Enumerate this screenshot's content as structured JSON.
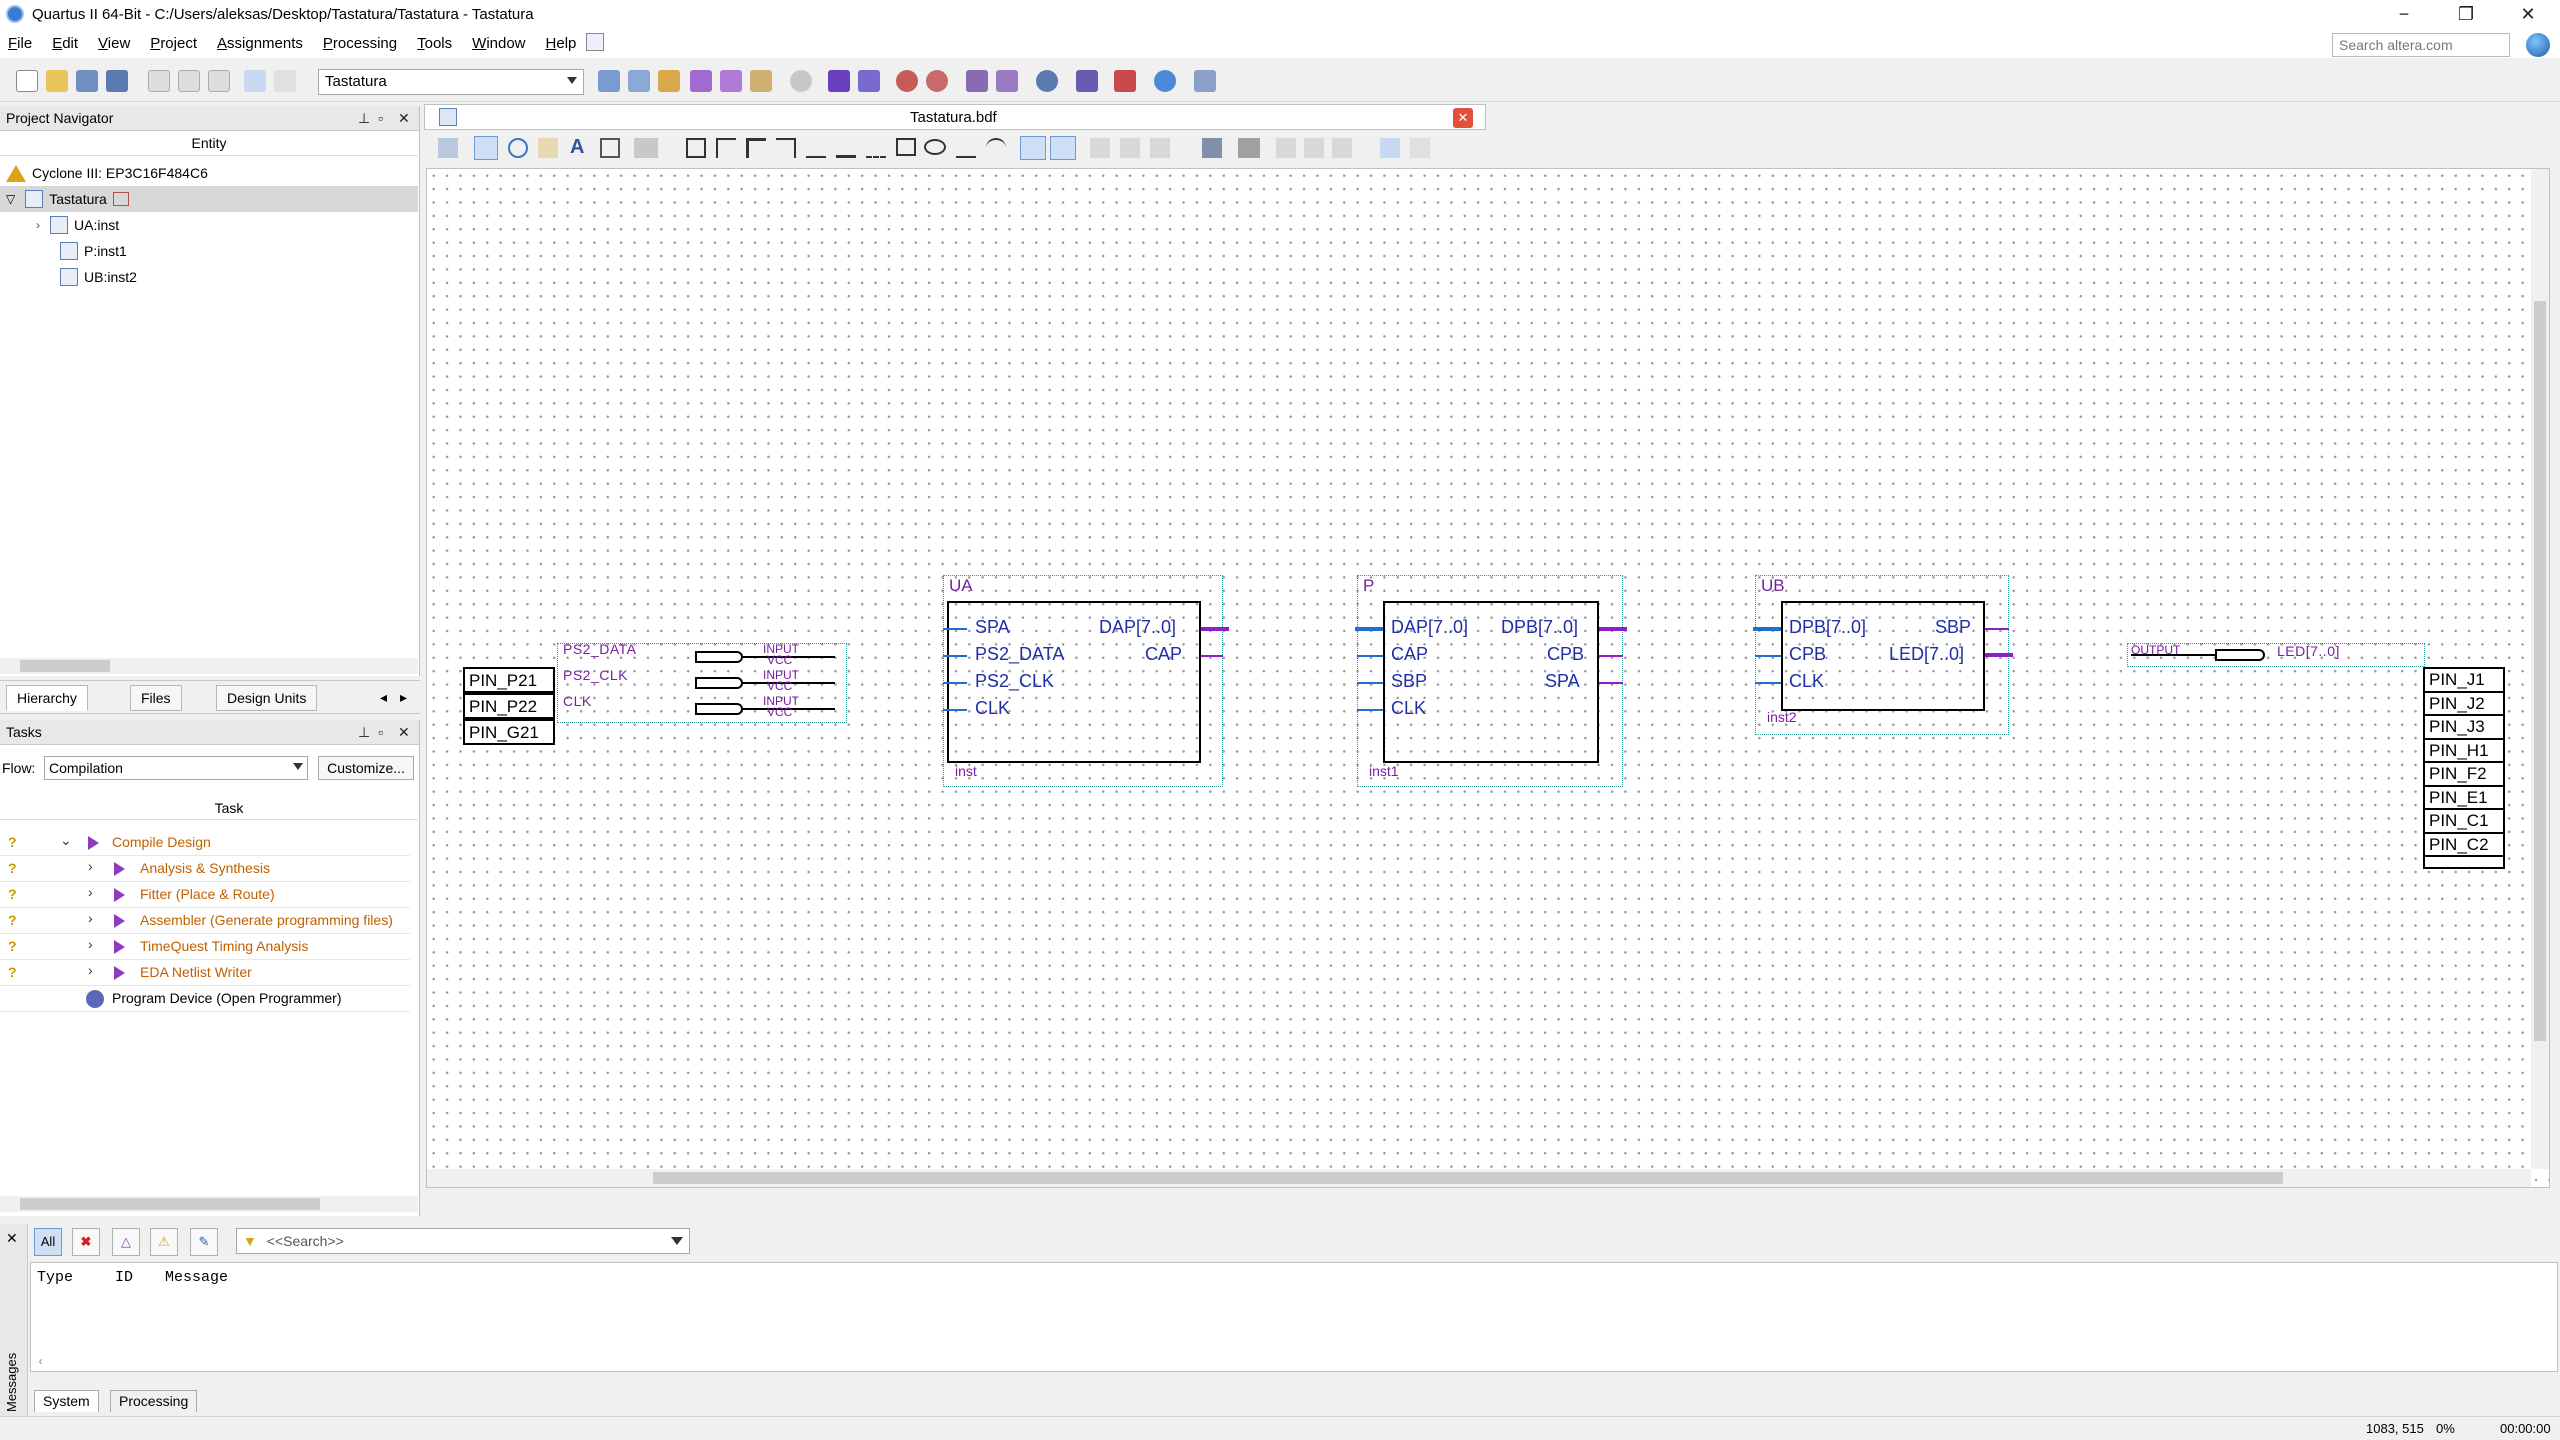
{
  "window": {
    "title": "Quartus II 64-Bit - C:/Users/aleksas/Desktop/Tastatura/Tastatura - Tastatura",
    "minimize": "−",
    "restore": "❐",
    "close": "✕"
  },
  "menu": [
    "File",
    "Edit",
    "View",
    "Project",
    "Assignments",
    "Processing",
    "Tools",
    "Window",
    "Help"
  ],
  "search": {
    "placeholder": "Search altera.com"
  },
  "toolbar": {
    "project": "Tastatura"
  },
  "navigator": {
    "title": "Project Navigator",
    "column": "Entity",
    "device": "Cyclone III: EP3C16F484C6",
    "root": "Tastatura",
    "children": [
      "UA:inst",
      "P:inst1",
      "UB:inst2"
    ]
  },
  "nav_tabs": [
    "Hierarchy",
    "Files",
    "Design Units"
  ],
  "tasks": {
    "title": "Tasks",
    "flow_label": "Flow:",
    "flow_value": "Compilation",
    "customize": "Customize...",
    "column": "Task",
    "items": [
      "Compile Design",
      "Analysis & Synthesis",
      "Fitter (Place & Route)",
      "Assembler (Generate programming files)",
      "TimeQuest Timing Analysis",
      "EDA Netlist Writer",
      "Program Device (Open Programmer)"
    ],
    "status_mark": "?"
  },
  "editor": {
    "file": "Tastatura.bdf"
  },
  "schematic": {
    "input_pins": [
      "PIN_P21",
      "PIN_P22",
      "PIN_G21"
    ],
    "input_signals": [
      "PS2_DATA",
      "PS2_CLK",
      "CLK"
    ],
    "input_type": "INPUT",
    "input_default": "VCC",
    "blocks": [
      {
        "name": "UA",
        "instance": "inst",
        "inputs": [
          "SPA",
          "PS2_DATA",
          "PS2_CLK",
          "CLK"
        ],
        "outputs": [
          "DAP[7..0]",
          "CAP"
        ]
      },
      {
        "name": "P",
        "instance": "inst1",
        "inputs": [
          "DAP[7..0]",
          "CAP",
          "SBP",
          "CLK"
        ],
        "outputs": [
          "DPB[7..0]",
          "CPB",
          "SPA"
        ]
      },
      {
        "name": "UB",
        "instance": "inst2",
        "inputs": [
          "DPB[7..0]",
          "CPB",
          "CLK"
        ],
        "outputs": [
          "SBP",
          "LED[7..0]"
        ]
      }
    ],
    "output_type": "OUTPUT",
    "output_signal": "LED[7..0]",
    "output_pins": [
      "PIN_J1",
      "PIN_J2",
      "PIN_J3",
      "PIN_H1",
      "PIN_F2",
      "PIN_E1",
      "PIN_C1",
      "PIN_C2"
    ]
  },
  "messages": {
    "filter_all": "All",
    "search_placeholder": "<<Search>>",
    "columns": [
      "Type",
      "ID",
      "Message"
    ],
    "tabs": [
      "System",
      "Processing"
    ],
    "side_label": "Messages"
  },
  "status": {
    "coords": "1083, 515",
    "percent": "0%",
    "time": "00:00:00"
  }
}
